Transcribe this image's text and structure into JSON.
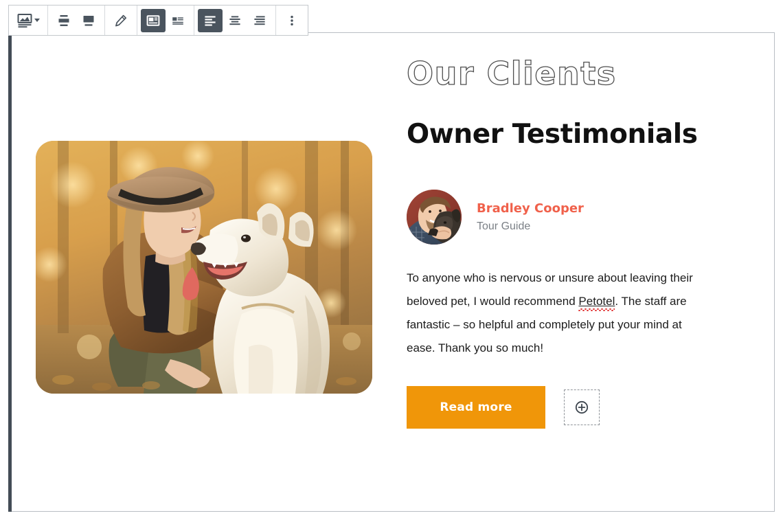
{
  "toolbar": {
    "groups": [
      {
        "name": "block-type",
        "buttons": [
          {
            "icon": "image-block-icon",
            "label": "Image block",
            "active": false,
            "has_caret": true
          }
        ]
      },
      {
        "name": "vertical-align",
        "buttons": [
          {
            "icon": "vertical-align-middle-icon",
            "label": "Vertical align middle",
            "active": false
          },
          {
            "icon": "vertical-align-bottom-icon",
            "label": "Vertical align bottom",
            "active": false
          }
        ]
      },
      {
        "name": "edit",
        "buttons": [
          {
            "icon": "pencil-icon",
            "label": "Edit",
            "active": false
          }
        ]
      },
      {
        "name": "media-position",
        "buttons": [
          {
            "icon": "media-left-icon",
            "label": "Show media on left",
            "active": true
          },
          {
            "icon": "media-right-icon",
            "label": "Show media on right",
            "active": false
          }
        ]
      },
      {
        "name": "text-align",
        "buttons": [
          {
            "icon": "align-left-icon",
            "label": "Align text left",
            "active": true
          },
          {
            "icon": "align-center-icon",
            "label": "Align text center",
            "active": false
          },
          {
            "icon": "align-right-icon",
            "label": "Align text right",
            "active": false
          }
        ]
      },
      {
        "name": "more",
        "buttons": [
          {
            "icon": "more-options-icon",
            "label": "Options",
            "active": false
          }
        ]
      }
    ]
  },
  "content": {
    "eyebrow_heading": "Our Clients",
    "main_heading": "Owner Testimonials",
    "hero_image_alt": "Woman in hat kneeling beside a white shepherd dog in autumn woods",
    "author": {
      "avatar_alt": "Smiling man holding a dark dog",
      "name": "Bradley Cooper",
      "role": "Tour Guide"
    },
    "testimonial": {
      "part_1": "To anyone who is nervous or unsure about leaving their beloved pet, I would recommend ",
      "misspelled_word": "Petotel",
      "part_2": ". The staff are fantastic – so helpful and completely put your mind at ease. Thank you so much!"
    },
    "cta": {
      "read_more_label": "Read more",
      "add_block_icon": "plus-circle-icon"
    }
  },
  "colors": {
    "accent_orange": "#f09609",
    "author_name": "#f0614b",
    "role_gray": "#7b8086",
    "toolbar_icon": "#4a545e",
    "selection_bar": "#434c56",
    "spellcheck_red": "#e03030"
  }
}
